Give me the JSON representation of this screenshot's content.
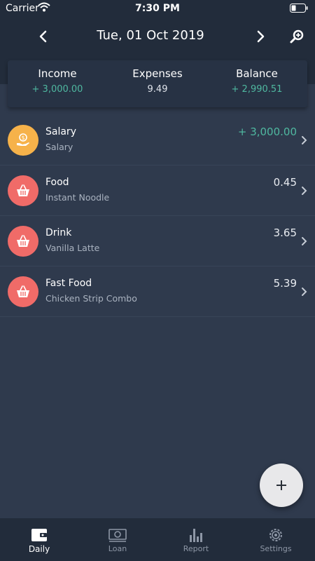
{
  "status_bar": {
    "carrier": "Carrier",
    "time": "7:30 PM"
  },
  "header": {
    "date": "Tue, 01 Oct 2019",
    "icons": [
      "chevron-left-icon",
      "chevron-right-icon",
      "search-zoom-icon"
    ]
  },
  "summary": {
    "income_label": "Income",
    "income_value": "+ 3,000.00",
    "expenses_label": "Expenses",
    "expenses_value": "9.49",
    "balance_label": "Balance",
    "balance_value": "+ 2,990.51"
  },
  "transactions": [
    {
      "title": "Salary",
      "subtitle": "Salary",
      "amount": "+ 3,000.00",
      "type": "income",
      "icon": "money-hand-icon",
      "color": "#f6b24a"
    },
    {
      "title": "Food",
      "subtitle": "Instant Noodle",
      "amount": "0.45",
      "type": "expense",
      "icon": "basket-icon",
      "color": "#f06b68"
    },
    {
      "title": "Drink",
      "subtitle": "Vanilla Latte",
      "amount": "3.65",
      "type": "expense",
      "icon": "basket-icon",
      "color": "#f06b68"
    },
    {
      "title": "Fast Food",
      "subtitle": "Chicken Strip Combo",
      "amount": "5.39",
      "type": "expense",
      "icon": "basket-icon",
      "color": "#f06b68"
    }
  ],
  "tabs": [
    {
      "label": "Daily",
      "icon": "wallet-icon",
      "active": true
    },
    {
      "label": "Loan",
      "icon": "cash-icon",
      "active": false
    },
    {
      "label": "Report",
      "icon": "bar-chart-icon",
      "active": false
    },
    {
      "label": "Settings",
      "icon": "gear-icon",
      "active": false
    }
  ],
  "colors": {
    "background": "#2f3a4d",
    "header": "#222c3b",
    "income_green": "#4fb8a0",
    "income_avatar": "#f6b24a",
    "expense_avatar": "#f06b68",
    "fab": "#e8e8ea"
  }
}
